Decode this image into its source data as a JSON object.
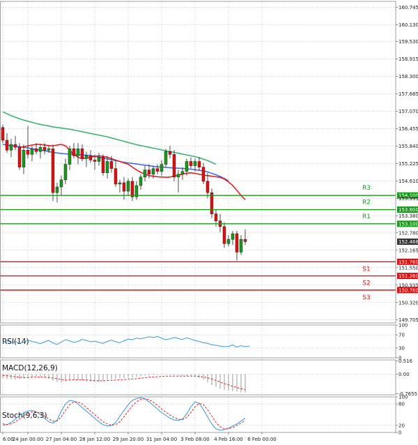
{
  "chart_data": {
    "type": "candlestick",
    "instrument_panes": {
      "main": {
        "y_ticks": [
          "160.745",
          "160.130",
          "159.530",
          "158.915",
          "158.300",
          "157.685",
          "157.070",
          "156.455",
          "155.840",
          "155.225",
          "154.610",
          "153.995",
          "153.380",
          "152.780",
          "152.165",
          "151.550",
          "150.935",
          "150.320",
          "149.705"
        ],
        "y_tick_values": [
          160.745,
          160.13,
          159.53,
          158.915,
          158.3,
          157.685,
          157.07,
          156.455,
          155.84,
          155.225,
          154.61,
          153.995,
          153.38,
          152.78,
          152.165,
          151.55,
          150.935,
          150.32,
          149.705
        ],
        "ylim": [
          149.6,
          160.95
        ],
        "current_price": {
          "label": "152.468",
          "value": 152.468
        },
        "levels": [
          {
            "name": "R3",
            "label": "154.100",
            "value": 154.1,
            "color": "#1a9a1a"
          },
          {
            "name": "R2",
            "label": "153.600",
            "value": 153.6,
            "color": "#1a9a1a"
          },
          {
            "name": "R1",
            "label": "153.100",
            "value": 153.1,
            "color": "#1a9a1a"
          },
          {
            "name": "S1",
            "label": "151.760",
            "value": 151.76,
            "color": "#e01010"
          },
          {
            "name": "S2",
            "label": "151.260",
            "value": 151.26,
            "color": "#e01010"
          },
          {
            "name": "S3",
            "label": "150.760",
            "value": 150.76,
            "color": "#e01010"
          }
        ],
        "ohlc": [
          [
            156.5,
            156.6,
            155.95,
            156.05
          ],
          [
            156.05,
            156.3,
            155.6,
            155.7
          ],
          [
            155.7,
            156.1,
            155.45,
            155.9
          ],
          [
            155.9,
            156.2,
            155.7,
            155.8
          ],
          [
            155.8,
            155.95,
            155.0,
            155.1
          ],
          [
            155.1,
            155.9,
            154.85,
            155.7
          ],
          [
            155.7,
            156.55,
            155.4,
            155.55
          ],
          [
            155.55,
            155.85,
            155.3,
            155.75
          ],
          [
            155.75,
            155.95,
            155.55,
            155.65
          ],
          [
            155.65,
            155.9,
            155.4,
            155.8
          ],
          [
            155.8,
            155.95,
            155.55,
            155.7
          ],
          [
            155.7,
            155.85,
            155.6,
            155.75
          ],
          [
            155.75,
            155.9,
            153.9,
            154.2
          ],
          [
            154.2,
            154.55,
            153.85,
            154.4
          ],
          [
            154.4,
            154.8,
            154.1,
            154.65
          ],
          [
            154.65,
            155.4,
            154.5,
            155.2
          ],
          [
            155.2,
            155.85,
            155.0,
            155.75
          ],
          [
            155.75,
            155.95,
            155.4,
            155.5
          ],
          [
            155.5,
            155.95,
            155.2,
            155.75
          ],
          [
            155.75,
            155.9,
            155.3,
            155.4
          ],
          [
            155.4,
            155.65,
            155.1,
            155.5
          ],
          [
            155.5,
            155.7,
            155.25,
            155.35
          ],
          [
            155.35,
            155.55,
            155.0,
            155.3
          ],
          [
            155.3,
            155.6,
            155.15,
            155.45
          ],
          [
            155.45,
            155.55,
            154.8,
            154.9
          ],
          [
            154.9,
            155.5,
            154.7,
            155.3
          ],
          [
            155.3,
            155.5,
            154.9,
            155.05
          ],
          [
            155.05,
            155.35,
            154.4,
            154.5
          ],
          [
            154.5,
            154.65,
            154.2,
            154.55
          ],
          [
            154.55,
            154.75,
            153.95,
            154.25
          ],
          [
            154.25,
            154.7,
            154.1,
            154.6
          ],
          [
            154.6,
            154.75,
            153.9,
            154.05
          ],
          [
            154.05,
            154.6,
            153.95,
            154.45
          ],
          [
            154.45,
            154.85,
            154.3,
            154.75
          ],
          [
            154.75,
            155.15,
            154.6,
            155.0
          ],
          [
            155.0,
            155.2,
            154.7,
            154.85
          ],
          [
            154.85,
            155.15,
            154.7,
            155.05
          ],
          [
            155.05,
            155.2,
            154.85,
            154.95
          ],
          [
            154.95,
            155.35,
            154.8,
            155.2
          ],
          [
            155.2,
            155.75,
            155.1,
            155.65
          ],
          [
            155.65,
            155.85,
            155.4,
            155.55
          ],
          [
            155.55,
            155.7,
            154.6,
            154.75
          ],
          [
            154.75,
            155.0,
            154.2,
            154.85
          ],
          [
            154.85,
            155.1,
            154.65,
            154.95
          ],
          [
            154.95,
            155.4,
            154.8,
            155.3
          ],
          [
            155.3,
            155.45,
            155.05,
            155.15
          ],
          [
            155.15,
            155.4,
            154.95,
            155.3
          ],
          [
            155.3,
            155.45,
            155.0,
            155.1
          ],
          [
            155.1,
            155.25,
            154.5,
            154.6
          ],
          [
            154.6,
            154.9,
            154.0,
            154.2
          ],
          [
            154.2,
            154.35,
            153.3,
            153.45
          ],
          [
            153.45,
            153.6,
            153.0,
            153.2
          ],
          [
            153.2,
            153.45,
            152.8,
            153.0
          ],
          [
            153.0,
            153.15,
            152.25,
            152.4
          ],
          [
            152.4,
            152.7,
            152.3,
            152.55
          ],
          [
            152.55,
            152.85,
            152.35,
            152.75
          ],
          [
            152.75,
            152.85,
            151.8,
            152.1
          ],
          [
            152.1,
            152.7,
            152.0,
            152.55
          ],
          [
            152.55,
            152.9,
            152.35,
            152.47
          ]
        ],
        "ma_green": [
          157.05,
          156.98,
          156.92,
          156.86,
          156.81,
          156.76,
          156.72,
          156.68,
          156.64,
          156.61,
          156.58,
          156.55,
          156.52,
          156.5,
          156.48,
          156.46,
          156.44,
          156.41,
          156.38,
          156.35,
          156.32,
          156.29,
          156.26,
          156.23,
          156.2,
          156.17,
          156.13,
          156.09,
          156.05,
          156.01,
          155.97,
          155.93,
          155.89,
          155.86,
          155.83,
          155.8,
          155.77,
          155.74,
          155.71,
          155.68,
          155.65,
          155.62,
          155.59,
          155.56,
          155.53,
          155.5,
          155.47,
          155.43,
          155.38,
          155.33,
          155.27,
          155.2
        ],
        "ma_blue": [
          155.9,
          155.88,
          155.86,
          155.84,
          155.82,
          155.8,
          155.78,
          155.75,
          155.72,
          155.7,
          155.68,
          155.65,
          155.62,
          155.6,
          155.58,
          155.57,
          155.56,
          155.55,
          155.54,
          155.53,
          155.52,
          155.51,
          155.48,
          155.45,
          155.42,
          155.39,
          155.36,
          155.33,
          155.3,
          155.27,
          155.25,
          155.23,
          155.21,
          155.19,
          155.17,
          155.15,
          155.13,
          155.11,
          155.1,
          155.09,
          155.08,
          155.07,
          155.06,
          155.05,
          155.04,
          155.03,
          155.01,
          154.99,
          154.96,
          154.93,
          154.88,
          154.83,
          154.77,
          154.7,
          154.62
        ],
        "ma_red": [
          155.8,
          155.82,
          155.85,
          155.88,
          155.9,
          155.9,
          155.88,
          155.86,
          155.85,
          155.88,
          155.9,
          155.85,
          155.7,
          155.55,
          155.45,
          155.4,
          155.42,
          155.45,
          155.48,
          155.5,
          155.48,
          155.45,
          155.4,
          155.35,
          155.3,
          155.25,
          155.2,
          155.1,
          155.0,
          154.92,
          154.85,
          154.8,
          154.78,
          154.76,
          154.75,
          154.74,
          154.75,
          154.78,
          154.82,
          154.85,
          154.88,
          154.9,
          154.88,
          154.85,
          154.82,
          154.8,
          154.78,
          154.76,
          154.74,
          154.68,
          154.58,
          154.45,
          154.28,
          154.1,
          153.95
        ]
      },
      "rsi": {
        "label": "RSI(14)",
        "y_ticks": [
          "100",
          "70",
          "30",
          "0"
        ],
        "y_tick_values": [
          100,
          70,
          30,
          0
        ],
        "ylim": [
          0,
          100
        ],
        "values": [
          48,
          52,
          46,
          50,
          44,
          48,
          54,
          50,
          47,
          43,
          49,
          53,
          45,
          41,
          48,
          55,
          52,
          47,
          50,
          56,
          53,
          49,
          51,
          47,
          44,
          50,
          54,
          49,
          46,
          52,
          57,
          55,
          60,
          58,
          61,
          64,
          62,
          65,
          60,
          55,
          58,
          62,
          59,
          56,
          61,
          57,
          53,
          50,
          46,
          44,
          40,
          38,
          36,
          34,
          35,
          39,
          33,
          37,
          34,
          36
        ]
      },
      "macd": {
        "label": "MACD(12,26,9)",
        "y_ticks": [
          "0.516",
          "0.00",
          "-0.7655"
        ],
        "y_tick_values": [
          0.516,
          0.0,
          -0.7655
        ],
        "ylim": [
          -0.8,
          0.55
        ],
        "histogram": [
          -0.15,
          -0.18,
          -0.2,
          -0.22,
          -0.2,
          -0.17,
          -0.14,
          -0.12,
          -0.1,
          -0.12,
          -0.15,
          -0.18,
          -0.26,
          -0.3,
          -0.32,
          -0.28,
          -0.22,
          -0.2,
          -0.22,
          -0.25,
          -0.28,
          -0.3,
          -0.32,
          -0.3,
          -0.26,
          -0.22,
          -0.2,
          -0.18,
          -0.16,
          -0.15,
          -0.14,
          -0.12,
          -0.1,
          -0.08,
          -0.06,
          -0.05,
          -0.04,
          -0.03,
          -0.02,
          -0.02,
          -0.03,
          -0.04,
          -0.05,
          -0.06,
          -0.07,
          -0.08,
          -0.1,
          -0.14,
          -0.22,
          -0.32,
          -0.42,
          -0.5,
          -0.56,
          -0.6,
          -0.64,
          -0.66,
          -0.68,
          -0.7,
          -0.71
        ],
        "signal": [
          -0.05,
          -0.06,
          -0.08,
          -0.1,
          -0.12,
          -0.13,
          -0.13,
          -0.12,
          -0.12,
          -0.12,
          -0.12,
          -0.13,
          -0.15,
          -0.18,
          -0.21,
          -0.23,
          -0.23,
          -0.22,
          -0.22,
          -0.22,
          -0.23,
          -0.24,
          -0.25,
          -0.26,
          -0.26,
          -0.25,
          -0.24,
          -0.23,
          -0.22,
          -0.21,
          -0.2,
          -0.19,
          -0.18,
          -0.16,
          -0.14,
          -0.12,
          -0.11,
          -0.1,
          -0.09,
          -0.08,
          -0.08,
          -0.08,
          -0.08,
          -0.08,
          -0.08,
          -0.08,
          -0.08,
          -0.09,
          -0.11,
          -0.14,
          -0.19,
          -0.25,
          -0.31,
          -0.37,
          -0.42,
          -0.47,
          -0.52,
          -0.56,
          -0.6
        ]
      },
      "stoch": {
        "label": "Stoch(9,6,3)",
        "y_ticks": [
          "100",
          "80",
          "20",
          "0"
        ],
        "y_tick_values": [
          100,
          80,
          20,
          0
        ],
        "ylim": [
          0,
          100
        ],
        "main": [
          20,
          22,
          28,
          38,
          48,
          55,
          60,
          62,
          58,
          50,
          40,
          30,
          26,
          35,
          60,
          80,
          90,
          88,
          80,
          70,
          60,
          50,
          40,
          30,
          22,
          18,
          20,
          28,
          45,
          62,
          78,
          90,
          95,
          98,
          94,
          86,
          76,
          66,
          56,
          48,
          40,
          35,
          34,
          38,
          52,
          72,
          86,
          82,
          64,
          44,
          24,
          10,
          6,
          8,
          12,
          18,
          24,
          32,
          40
        ],
        "signal": [
          24,
          22,
          24,
          30,
          38,
          46,
          54,
          58,
          58,
          54,
          46,
          38,
          32,
          32,
          44,
          62,
          78,
          86,
          86,
          80,
          70,
          60,
          50,
          40,
          30,
          24,
          20,
          22,
          30,
          44,
          60,
          75,
          86,
          93,
          95,
          92,
          85,
          76,
          66,
          57,
          49,
          42,
          37,
          36,
          42,
          56,
          72,
          82,
          78,
          64,
          46,
          28,
          16,
          10,
          10,
          14,
          20,
          26,
          34
        ]
      }
    },
    "x_tick_labels": [
      "6:00",
      "24 Jan 00:00",
      "27 Jan 04:00",
      "28 Jan 12:00",
      "29 Jan 20:00",
      "31 Jan 04:00",
      "3 Feb 08:00",
      "4 Feb 16:00",
      "6 Feb 00:00"
    ],
    "colors": {
      "up": "#1a9a1a",
      "down": "#e01010",
      "ma_green": "#3cb371",
      "ma_blue": "#3f6fe6",
      "ma_red": "#e62020",
      "indicator_line": "#3399dd",
      "signal_line": "#e62020",
      "grid": "#b8b8b8",
      "current_price_tag": "#333333"
    }
  }
}
